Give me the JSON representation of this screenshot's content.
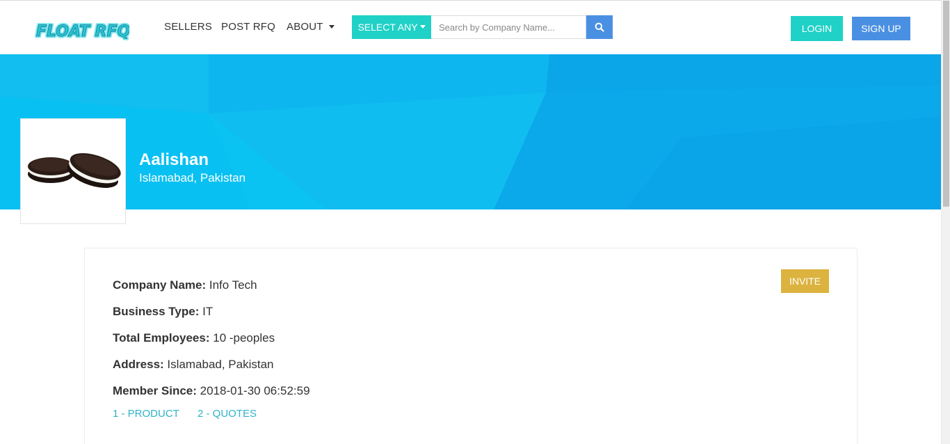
{
  "header": {
    "logo_text": "FLOAT RFQ",
    "nav": {
      "sellers": "SELLERS",
      "post_rfq": "POST RFQ",
      "about": "ABOUT"
    },
    "search": {
      "select_label": "SELECT ANY",
      "placeholder": "Search by Company Name..."
    },
    "login_label": "LOGIN",
    "signup_label": "SIGN UP"
  },
  "profile": {
    "name": "Aalishan",
    "location": "Islamabad, Pakistan",
    "avatar_icon": "cookie-image"
  },
  "details": {
    "invite_label": "INVITE",
    "fields": [
      {
        "label": "Company Name:",
        "value": "Info Tech"
      },
      {
        "label": "Business Type:",
        "value": "IT"
      },
      {
        "label": "Total Employees:",
        "value": "10 -peoples"
      },
      {
        "label": "Address:",
        "value": "Islamabad, Pakistan"
      },
      {
        "label": "Member Since:",
        "value": "2018-01-30 06:52:59"
      }
    ],
    "tabs": [
      {
        "label": "1 - PRODUCT"
      },
      {
        "label": "2 - QUOTES"
      }
    ]
  },
  "colors": {
    "teal": "#1fd1c7",
    "blue": "#4a90e2",
    "banner": "#0fb3ec",
    "invite": "#dcb33f",
    "link": "#2fb3c7"
  }
}
